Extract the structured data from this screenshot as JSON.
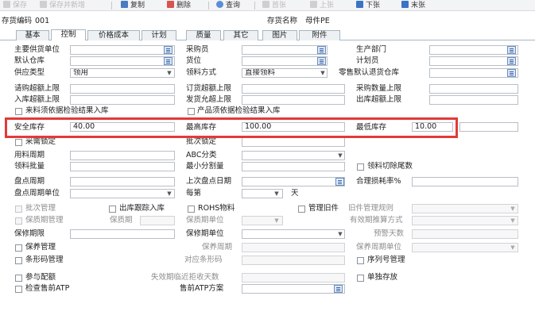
{
  "toolbar": {
    "save": "保存",
    "save_new": "保存并新增",
    "copy": "复制",
    "delete": "删除",
    "query": "查询",
    "first": "首张",
    "prev": "上张",
    "next": "下张",
    "last": "末张",
    "colors": {
      "save": "#bfbfbf",
      "copy": "#4a7cc0",
      "delete": "#d9534f",
      "query": "#5b8ed6",
      "nav": "#3a74c4"
    }
  },
  "header": {
    "code_label": "存货编码",
    "code_value": "001",
    "name_label": "存货名称",
    "name_value": "母件PE"
  },
  "tabs": [
    "基本",
    "控制",
    "价格成本",
    "计划",
    "质量",
    "其它",
    "图片",
    "附件"
  ],
  "form": {
    "main_supplier": "主要供货单位",
    "buyer": "采购员",
    "prod_dept": "生产部门",
    "default_wh": "默认仓库",
    "location": "货位",
    "planner": "计划员",
    "supply_type": "供应类型",
    "supply_type_val": "领用",
    "pick_method": "领料方式",
    "pick_method_val": "直接领料",
    "retail_return_wh": "零售默认退货仓库",
    "req_over_limit": "请购超额上限",
    "order_over_limit": "订货超额上限",
    "purchase_qty_limit": "采购数量上限",
    "in_over_limit": "入库超额上限",
    "ship_allow_limit": "发货允超上限",
    "out_over_limit": "出库超额上限",
    "in_qc_check": "来料须依据检验结果入库",
    "product_qc_check": "产品须依据检验结果入库",
    "safety_stock": "安全库存",
    "safety_stock_val": "40.00",
    "max_stock": "最高库存",
    "max_stock_val": "100.00",
    "min_stock": "最低库存",
    "min_stock_val": "10.00",
    "lock_label_a": "采需锁定",
    "lock_label_b": "批次锁定",
    "usage_period": "用料周期",
    "abc_class": "ABC分类",
    "pick_batch": "领料批量",
    "min_split": "最小分割量",
    "pick_cut_tail": "领料切除尾数",
    "count_cycle": "盘点周期",
    "last_count_date": "上次盘点日期",
    "loss_rate": "合理损耗率%",
    "count_cycle_unit": "盘点周期单位",
    "every_week": "每第",
    "day": "天",
    "batch_mgmt": "批次管理",
    "out_track_in": "出库跟踪入库",
    "rohs": "ROHS物料",
    "old_mgmt": "管理旧件",
    "old_rule": "旧件管理规则",
    "shelf_mgmt": "保质期管理",
    "shelf_period": "保质期",
    "shelf_unit": "保质期单位",
    "valid_period_method": "有效期推算方式",
    "warranty_limit": "保修期限",
    "warranty_unit": "保修期单位",
    "warning_days": "预警天数",
    "maint_mgmt": "保养管理",
    "maint_period": "保养周期",
    "maint_period_unit": "保养周期单位",
    "barcode_mgmt": "条形码管理",
    "barcode_map": "对应条形码",
    "serial_mgmt": "序列号管理",
    "join_config": "参与配额",
    "expire_reject_days": "失效期临近拒收天数",
    "separate_store": "单独存放",
    "check_atp": "检查售前ATP",
    "atp_plan": "售前ATP方案"
  }
}
